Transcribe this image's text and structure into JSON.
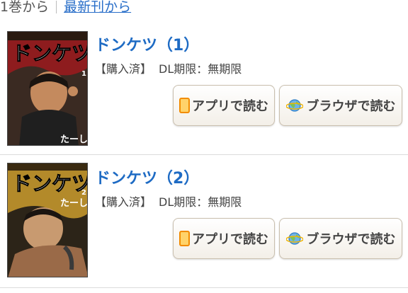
{
  "sort": {
    "option_first": "1巻から",
    "option_latest": "最新刊から"
  },
  "items": [
    {
      "title": "ドンケツ（1）",
      "status": "【購入済】",
      "dl": "DL期限：無期限",
      "app_button": "アプリで読む",
      "browser_button": "ブラウザで読む",
      "cover": {
        "logo": "ドンケツ",
        "volume": "1",
        "author": "たーし",
        "bg": "#b3262a"
      }
    },
    {
      "title": "ドンケツ（2）",
      "status": "【購入済】",
      "dl": "DL期限：無期限",
      "app_button": "アプリで読む",
      "browser_button": "ブラウザで読む",
      "cover": {
        "logo": "ドンケツ",
        "volume": "2",
        "author": "たーし",
        "bg": "#c9a23a"
      }
    }
  ],
  "colors": {
    "link": "#2a6fc9",
    "title": "#1e6bc4",
    "app_icon": "#f28c00",
    "globe": "#3a8fd8"
  },
  "icons": {
    "app": "smartphone-icon",
    "browser": "globe-icon"
  }
}
